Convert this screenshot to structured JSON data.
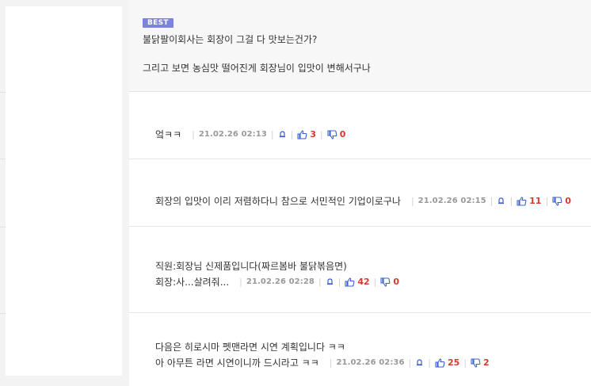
{
  "best": {
    "badge": "BEST",
    "lines": [
      "불닭팔이회사는 회장이 그걸 다 맛보는건가?",
      "그리고 보면 농심맛 떨어진게 회장님이 입맛이 변해서구나"
    ]
  },
  "comments": [
    {
      "lines": [
        "엌ㅋㅋ"
      ],
      "date": "21.02.26 02:13",
      "likes": "3",
      "dislikes": "0"
    },
    {
      "lines": [
        "회장의 입맛이 이리 저렴하다니 참으로 서민적인 기업이로구나"
      ],
      "date": "21.02.26 02:15",
      "likes": "11",
      "dislikes": "0"
    },
    {
      "lines": [
        "직원:회장님 신제품입니다(짜르봄바 불닭볶음면)",
        "회장:사...살려줘..."
      ],
      "date": "21.02.26 02:28",
      "likes": "42",
      "dislikes": "0"
    },
    {
      "lines": [
        "다음은 히로시마 펫맨라면 시연 계획입니다 ㅋㅋ",
        "아 아무튼 라면 시연이니까 드시라고 ㅋㅋ"
      ],
      "date": "21.02.26 02:36",
      "likes": "25",
      "dislikes": "2"
    }
  ],
  "icons": {
    "report": "bell-report-icon",
    "like": "thumbs-up-icon",
    "dislike": "thumbs-down-icon"
  },
  "colors": {
    "badge": "#7b84d8",
    "count": "#d43a2e",
    "icon": "#3a62c8"
  }
}
